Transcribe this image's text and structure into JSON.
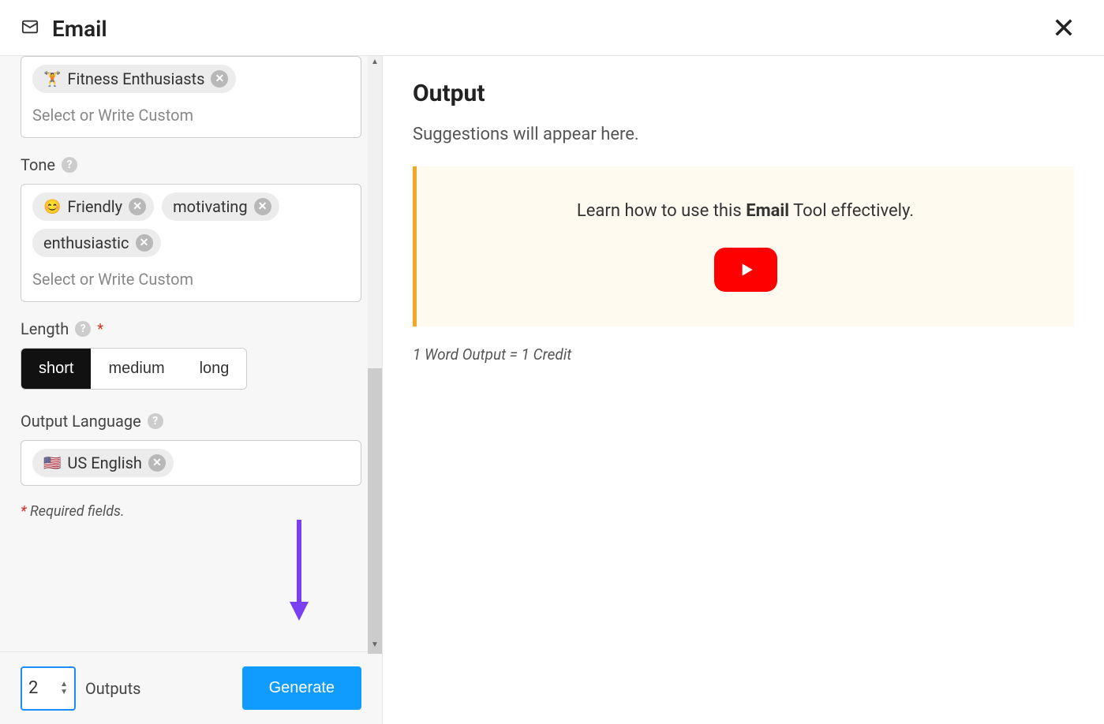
{
  "header": {
    "title": "Email"
  },
  "form": {
    "audience": {
      "tags": [
        {
          "icon": "🏋️",
          "label": "Fitness Enthusiasts"
        }
      ],
      "placeholder": "Select or Write Custom"
    },
    "tone": {
      "label": "Tone",
      "tags": [
        {
          "icon": "😊",
          "label": "Friendly"
        },
        {
          "icon": "",
          "label": "motivating"
        },
        {
          "icon": "",
          "label": "enthusiastic"
        }
      ],
      "placeholder": "Select or Write Custom"
    },
    "length": {
      "label": "Length",
      "options": [
        "short",
        "medium",
        "long"
      ],
      "selected": "short"
    },
    "language": {
      "label": "Output Language",
      "tags": [
        {
          "icon": "🇺🇸",
          "label": "US English"
        }
      ]
    },
    "required_note": "Required fields."
  },
  "footer": {
    "count": "2",
    "outputs_label": "Outputs",
    "generate": "Generate"
  },
  "output": {
    "title": "Output",
    "subtitle": "Suggestions will appear here.",
    "info_prefix": "Learn how to use this ",
    "info_bold": "Email",
    "info_suffix": " Tool effectively.",
    "credit": "1 Word Output = 1 Credit"
  }
}
